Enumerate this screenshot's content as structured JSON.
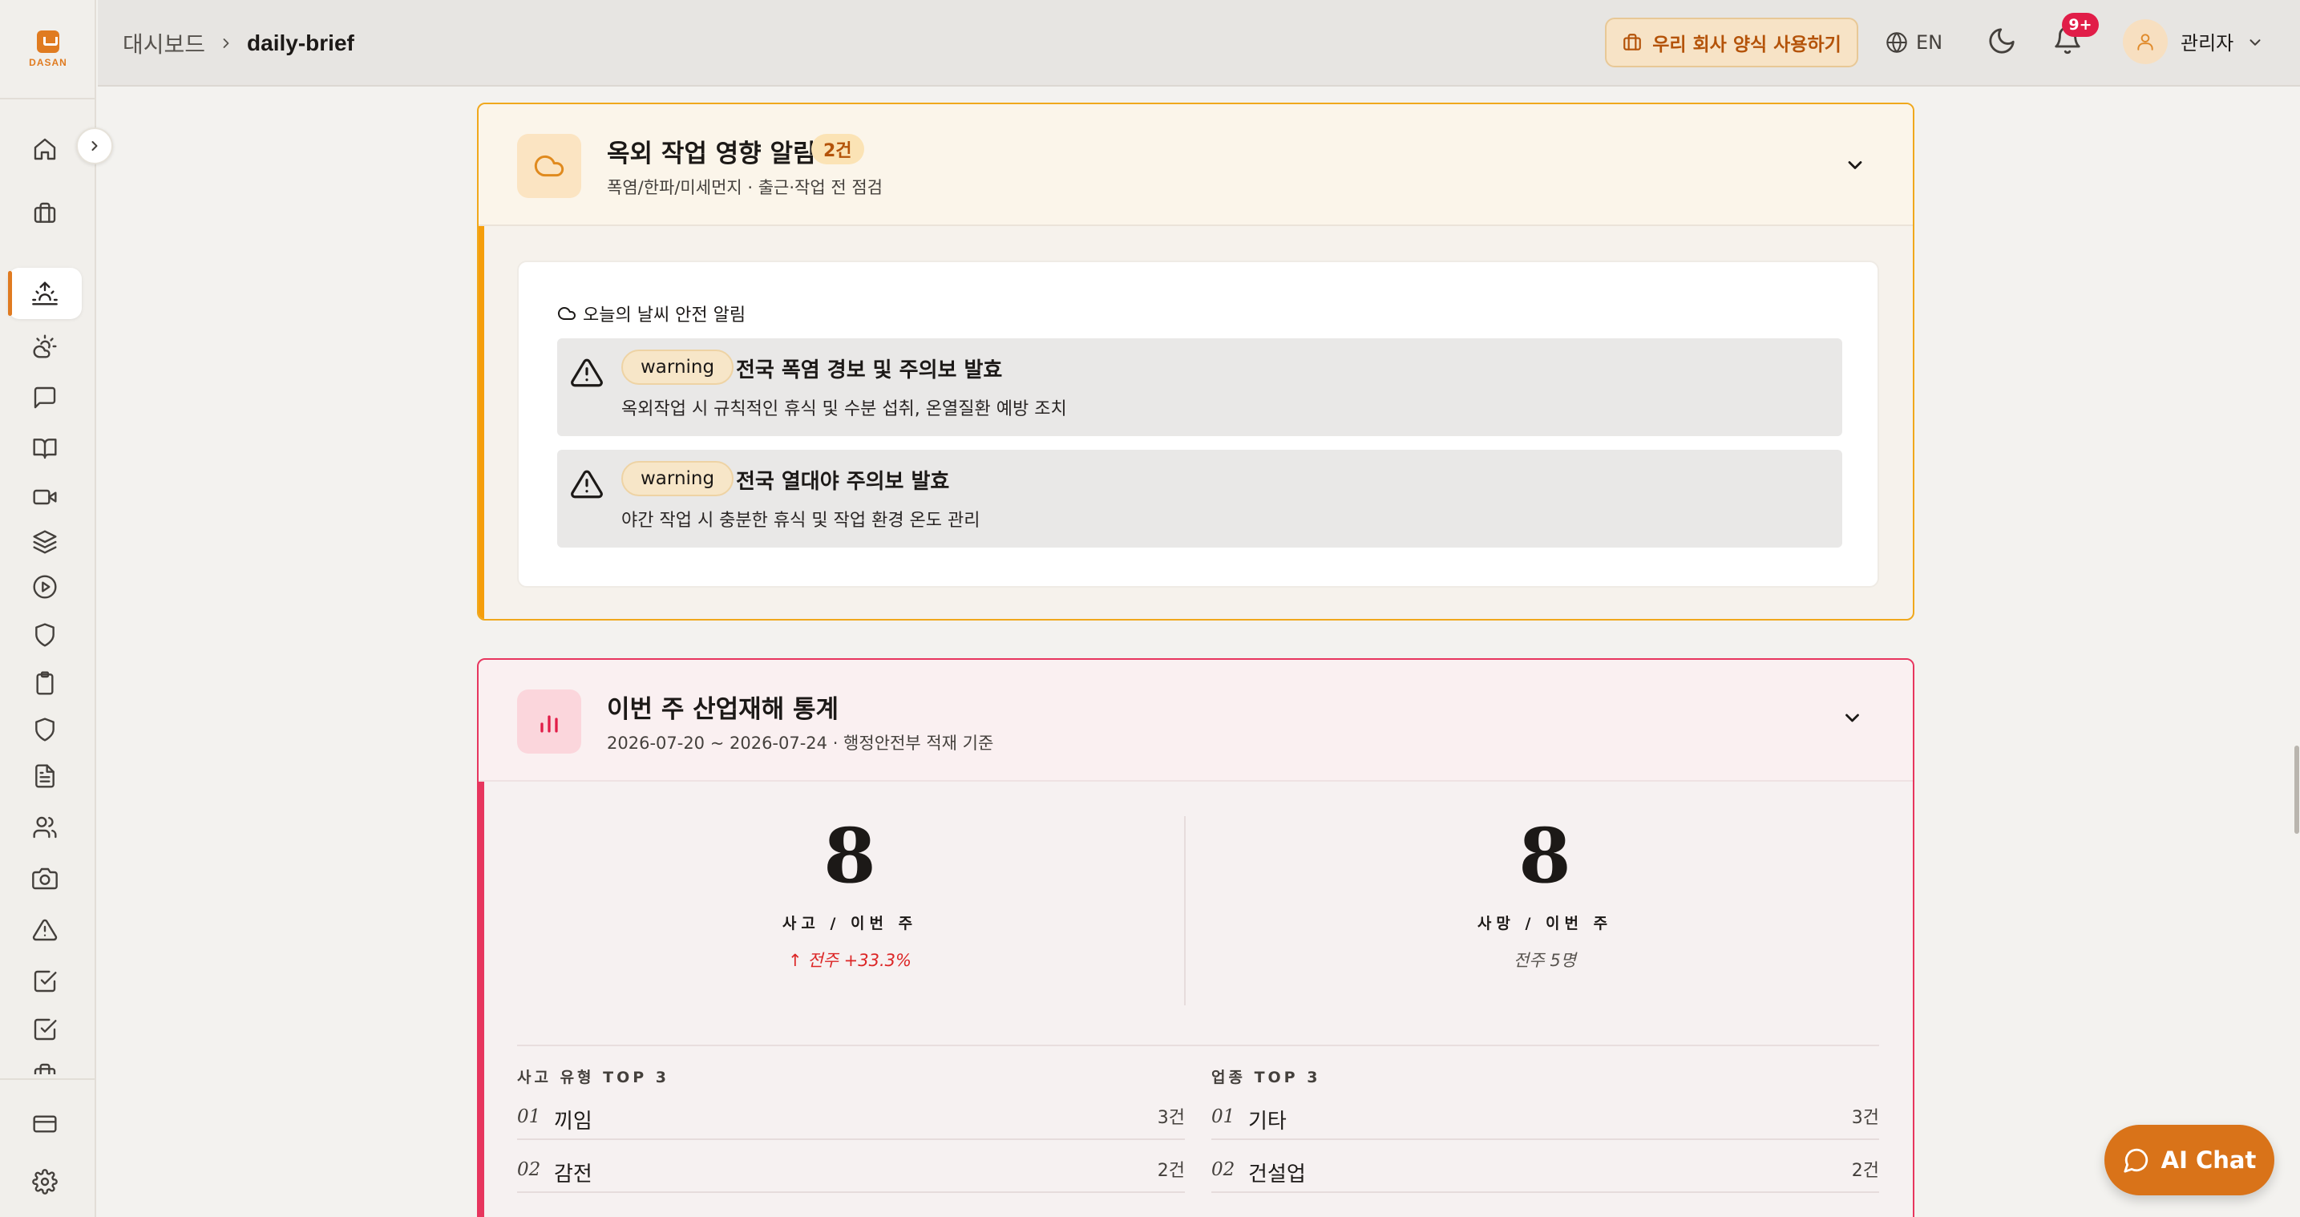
{
  "sidebar": {
    "logo_text": "DASAN",
    "items": [
      {
        "icon": "home-icon"
      },
      {
        "icon": "briefcase-icon"
      },
      {
        "icon": "sunrise-icon",
        "active": true
      },
      {
        "icon": "cloud-sun-icon"
      },
      {
        "icon": "message-icon"
      },
      {
        "icon": "book-icon"
      },
      {
        "icon": "video-icon"
      },
      {
        "icon": "layers-icon"
      },
      {
        "icon": "play-circle-icon"
      },
      {
        "icon": "shield-icon"
      },
      {
        "icon": "clipboard-icon"
      },
      {
        "icon": "shield-icon"
      },
      {
        "icon": "file-text-icon"
      },
      {
        "icon": "users-icon"
      },
      {
        "icon": "camera-icon"
      },
      {
        "icon": "alert-triangle-icon"
      },
      {
        "icon": "check-square-icon"
      },
      {
        "icon": "check-square-icon"
      },
      {
        "icon": "briefcase-icon"
      }
    ],
    "bottom_items": [
      {
        "icon": "credit-card-icon"
      },
      {
        "icon": "settings-icon"
      }
    ]
  },
  "header": {
    "breadcrumb_home": "대시보드",
    "breadcrumb_current": "daily-brief",
    "template_button": "우리 회사 양식 사용하기",
    "language": "EN",
    "notification_badge": "9+",
    "user_name": "관리자"
  },
  "weather_card": {
    "title": "옥외 작업 영향 알림",
    "count": "2건",
    "subtitle": "폭염/한파/미세먼지 · 출근·작업 전 점검",
    "section_heading": "오늘의 날씨 안전 알림",
    "alerts": [
      {
        "level": "warning",
        "title": "전국 폭염 경보 및 주의보 발효",
        "description": "옥외작업 시 규칙적인 휴식 및 수분 섭취, 온열질환 예방 조치"
      },
      {
        "level": "warning",
        "title": "전국 열대야 주의보 발효",
        "description": "야간 작업 시 충분한 휴식 및 작업 환경 온도 관리"
      }
    ]
  },
  "stats_card": {
    "title": "이번 주 산업재해 통계",
    "subtitle": "2026-07-20 ~ 2026-07-24 · 행정안전부 적재 기준",
    "accidents": {
      "value": "8",
      "label": "사고 / 이번 주",
      "delta": "↑ 전주 +33.3%"
    },
    "deaths": {
      "value": "8",
      "label": "사망 / 이번 주",
      "delta": "전주 5명"
    },
    "accident_types": {
      "heading": "사고 유형 TOP 3",
      "rows": [
        {
          "rank": "01",
          "name": "끼임",
          "count": "3건"
        },
        {
          "rank": "02",
          "name": "감전",
          "count": "2건"
        }
      ]
    },
    "industries": {
      "heading": "업종 TOP 3",
      "rows": [
        {
          "rank": "01",
          "name": "기타",
          "count": "3건"
        },
        {
          "rank": "02",
          "name": "건설업",
          "count": "2건"
        }
      ]
    }
  },
  "ai_chat": {
    "label": "AI Chat"
  },
  "colors": {
    "accent": "#e07b20",
    "weather_border": "#f59e0b",
    "stats_border": "#e7365e",
    "delta_up": "#dc2626"
  }
}
